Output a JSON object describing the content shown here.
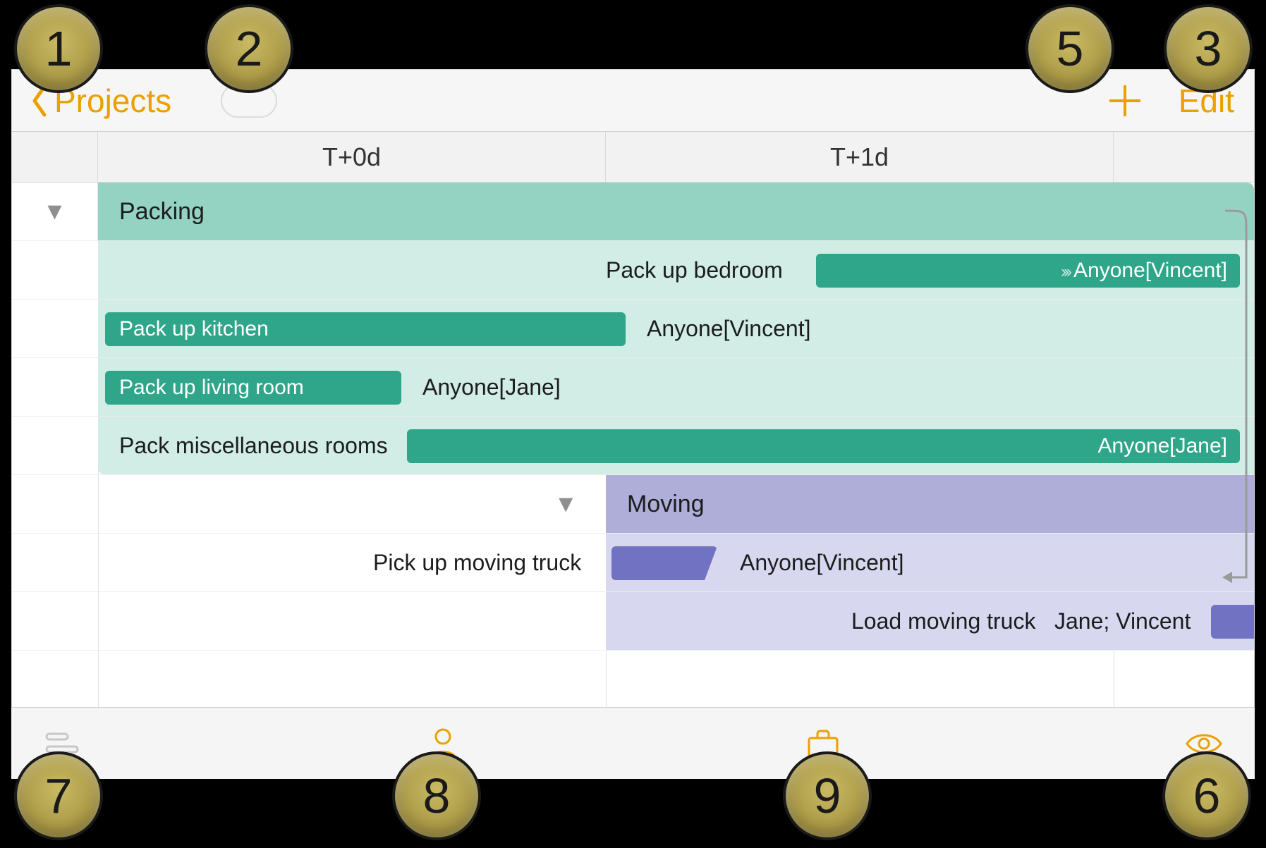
{
  "nav": {
    "back_label": "Projects",
    "edit_label": "Edit"
  },
  "timeline": {
    "columns": [
      "T+0d",
      "T+1d"
    ]
  },
  "groups": [
    {
      "name": "Packing",
      "color": "teal",
      "tasks": [
        {
          "name": "Pack up bedroom",
          "assignee": "Anyone[Vincent]",
          "label_side": "before",
          "bar_text_side": "right",
          "continues": true
        },
        {
          "name": "Pack up kitchen",
          "assignee": "Anyone[Vincent]",
          "label_side": "inside",
          "assignee_side": "after"
        },
        {
          "name": "Pack up living room",
          "assignee": "Anyone[Jane]",
          "label_side": "inside",
          "assignee_side": "after"
        },
        {
          "name": "Pack miscellaneous rooms",
          "assignee": "Anyone[Jane]",
          "label_side": "before",
          "bar_text_side": "right"
        }
      ]
    },
    {
      "name": "Moving",
      "color": "purple",
      "tasks": [
        {
          "name": "Pick up moving truck",
          "assignee": "Anyone[Vincent]",
          "label_side": "before",
          "assignee_side": "after"
        },
        {
          "name": "Load moving truck",
          "assignee": "Jane; Vincent",
          "label_side": "before",
          "assignee_side": "before-bar"
        }
      ]
    }
  ],
  "callouts": [
    "1",
    "2",
    "3",
    "5",
    "6",
    "7",
    "8",
    "9"
  ]
}
